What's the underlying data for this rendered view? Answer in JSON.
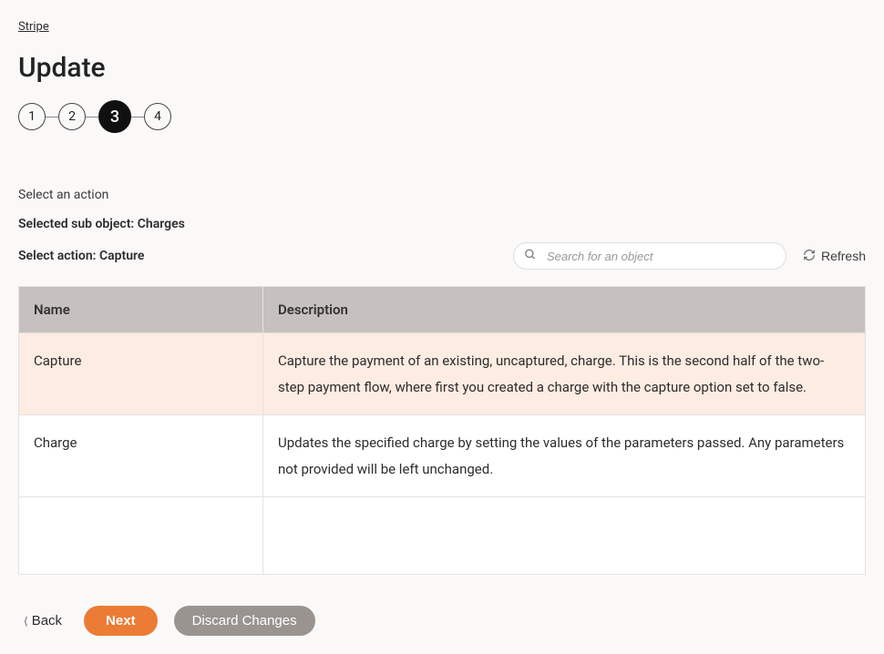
{
  "breadcrumb": {
    "root": "Stripe"
  },
  "page_title": "Update",
  "stepper": {
    "steps": [
      "1",
      "2",
      "3",
      "4"
    ],
    "active_index": 2
  },
  "section_label": "Select an action",
  "selected_sub_object": {
    "label": "Selected sub object:",
    "value": "Charges"
  },
  "select_action": {
    "label": "Select action:",
    "value": "Capture"
  },
  "search": {
    "placeholder": "Search for an object"
  },
  "refresh_label": "Refresh",
  "table": {
    "headers": {
      "name": "Name",
      "description": "Description"
    },
    "rows": [
      {
        "name": "Capture",
        "description": "Capture the payment of an existing, uncaptured, charge. This is the second half of the two-step payment flow, where first you created a charge with the capture option set to false.",
        "selected": true
      },
      {
        "name": "Charge",
        "description": "Updates the specified charge by setting the values of the parameters passed. Any parameters not provided will be left unchanged.",
        "selected": false
      }
    ]
  },
  "footer": {
    "back": "Back",
    "next": "Next",
    "discard": "Discard Changes"
  }
}
